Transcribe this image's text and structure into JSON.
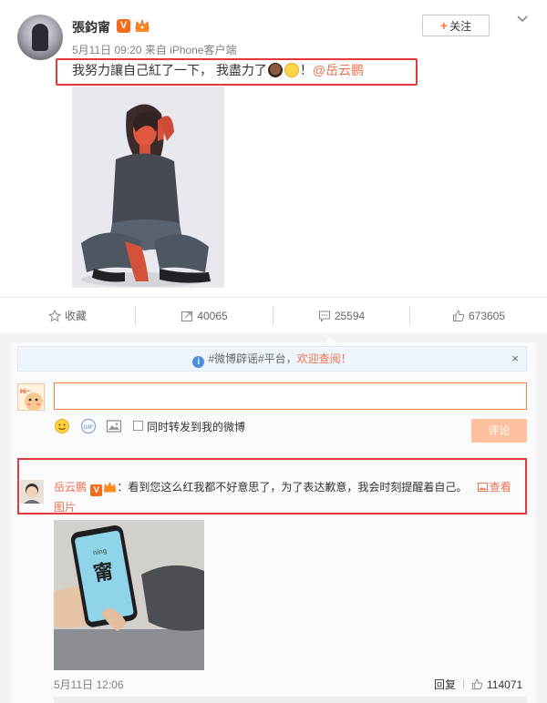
{
  "post": {
    "username": "張鈞甯",
    "meta": "5月11日 09:20 来自 iPhone客户端",
    "follow_label": "关注",
    "text_before": "我努力讓自己紅了一下， 我盡力了",
    "text_after": "！",
    "mention": "@岳云鹏",
    "badge": "V"
  },
  "actions": {
    "favorite_label": "收藏",
    "repost_count": "40065",
    "comment_count": "25594",
    "like_count": "673605"
  },
  "comments": {
    "notice_before": "#微博辟谣#平台，",
    "notice_link": "欢迎查阅！",
    "notice_close": "×",
    "input_value": "",
    "forward_label": "同时转发到我的微博",
    "submit_label": "评论",
    "reply": {
      "name": "岳云鹏",
      "badge": "V",
      "text": "：看到您这么红我都不好意思了，为了表达歉意，我会时刻提醒着自己。",
      "view_link": "查看图片",
      "time": "5月11日 12:06",
      "reply_label": "回复",
      "like_count": "114071"
    },
    "phone_screen": {
      "char": "甯",
      "pinyin": "níng"
    }
  },
  "colors": {
    "accent": "#eb7350",
    "follow_plus": "#fa7d3c",
    "highlight_box": "#e4383b",
    "submit_bg": "#ffc09f"
  }
}
